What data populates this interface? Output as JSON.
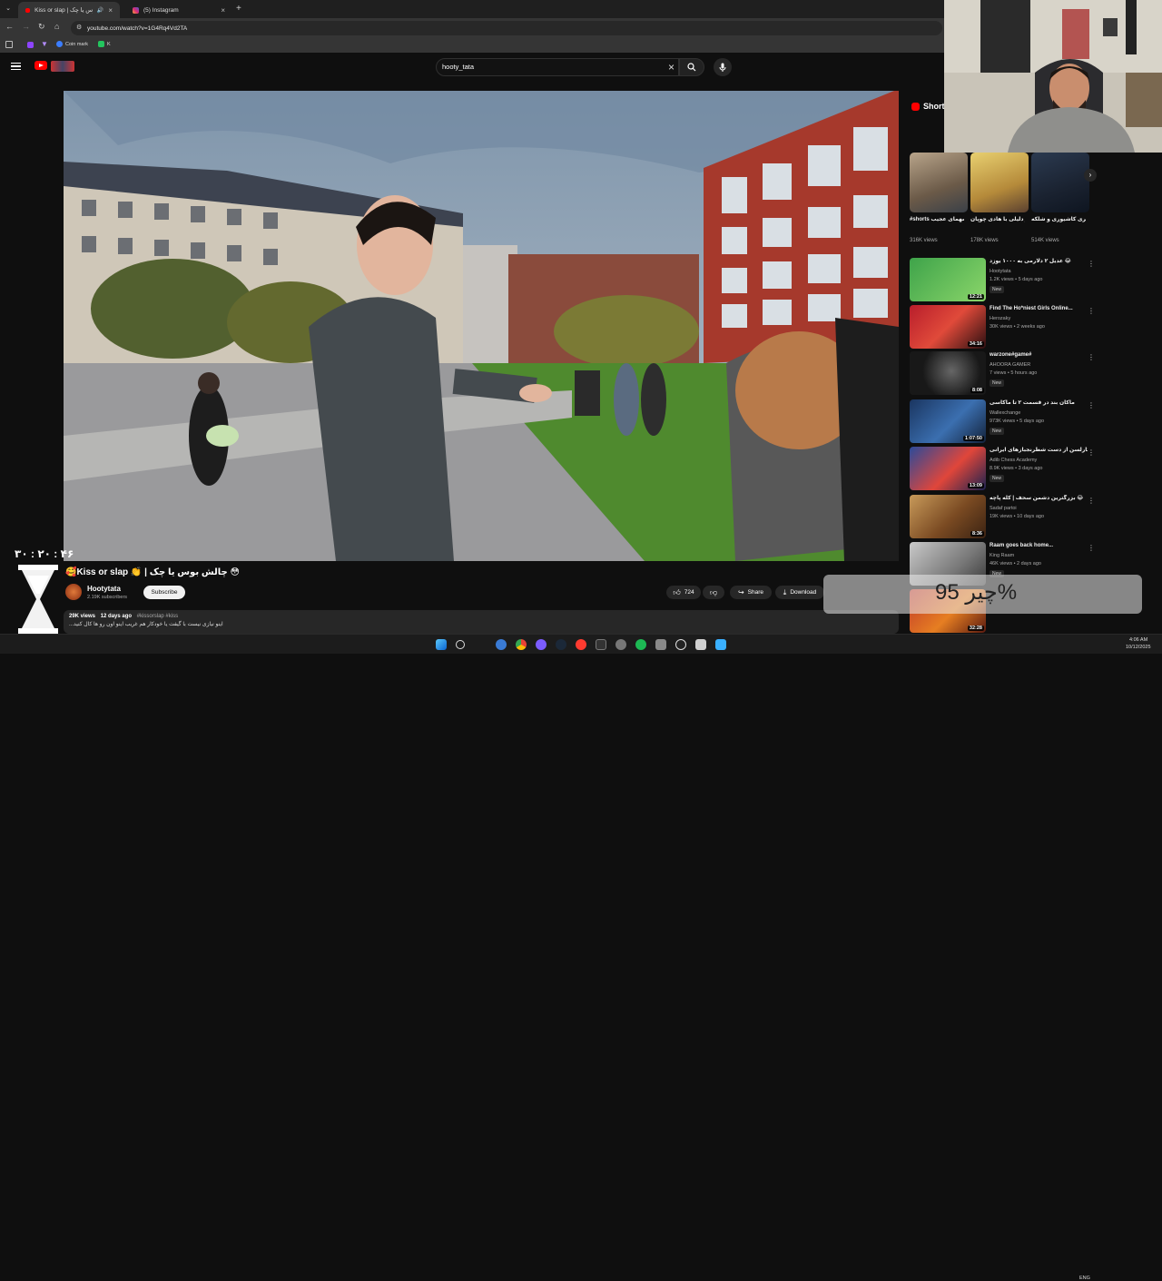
{
  "browser": {
    "tabs": [
      {
        "label": "Kiss or slap | چالش بوس یا چک",
        "active": true
      },
      {
        "label": "(5) Instagram",
        "active": false
      }
    ],
    "url": "youtube.com/watch?v=1G4Rq4Vd2TA",
    "bookmarks": [
      "Coin mark",
      "K"
    ]
  },
  "youtube": {
    "search_query": "hooty_tata",
    "video": {
      "title": "🥰Kiss or slap 👏 | چالش بوس یا چک 😳",
      "channel": "Hootytata",
      "subscribers": "2.19K subscribers",
      "subscribe_label": "Subscribe",
      "likes": "724",
      "share_label": "Share",
      "download_label": "Download",
      "views": "29K views",
      "age": "12 days ago",
      "hashtags": "#kissorslap #kiss",
      "description": "اینو نیازی نیست با گیفت یا خودکار هم غریب اینو اون رو ها کال کنید..."
    },
    "shorts_label": "Shorts",
    "shorts": [
      {
        "title": "#shorts ملکر کرشهمای عجیب",
        "views": "316K views"
      },
      {
        "title": "بیزینر دلیلی با هادی چوپان",
        "views": "178K views"
      },
      {
        "title": "درگیری کاشیوری و شلکه ❌😱",
        "views": "514K views"
      }
    ],
    "recommended": [
      {
        "title": "عدیل ۲ دلارمی به ۱۰۰۰ یوزد 😂",
        "channel": "Hootytata",
        "meta": "1.2K views • 5 days ago",
        "badge": "New",
        "duration": "12:21"
      },
      {
        "title": "Find The Ho*niest Girls Online...",
        "channel": "Herozaky",
        "meta": "30K views • 2 weeks ago",
        "badge": "",
        "duration": "34:16"
      },
      {
        "title": "warzone#game#",
        "channel": "AHOORA GAMER",
        "meta": "7 views • 5 hours ago",
        "badge": "New",
        "duration": "8:08"
      },
      {
        "title": "ماکان بند در قسمت ۲ تا ماکاسی",
        "channel": "Wallexchange",
        "meta": "973K views • 5 days ago",
        "badge": "New",
        "duration": "1:07:50"
      },
      {
        "title": "مگنوس کارلسن از دست شطرنجبازهای ایرانی",
        "channel": "Adib Chess Academy",
        "meta": "8.9K views • 3 days ago",
        "badge": "New",
        "duration": "13:09"
      },
      {
        "title": "بزرگترین دشمن سحف | کله پاچه 😂",
        "channel": "Sadaf partoi",
        "meta": "19K views • 10 days ago",
        "badge": "",
        "duration": "8:36"
      },
      {
        "title": "Raam goes back home...",
        "channel": "King Raam",
        "meta": "46K views • 2 days ago",
        "badge": "New",
        "duration": ""
      },
      {
        "title": "",
        "channel": "",
        "meta": "",
        "badge": "",
        "duration": "32:28"
      }
    ]
  },
  "overlay": {
    "timer": "۳۰ : ۲۰ : ۴۶",
    "text": "چیر 95%"
  },
  "taskbar": {
    "language": "ENG",
    "time": "4:06 AM",
    "date": "10/12/2025"
  },
  "colors": {
    "accent_red": "#ff0000",
    "yt_bg": "#0f0f0f",
    "chrome_bg": "#353535"
  }
}
